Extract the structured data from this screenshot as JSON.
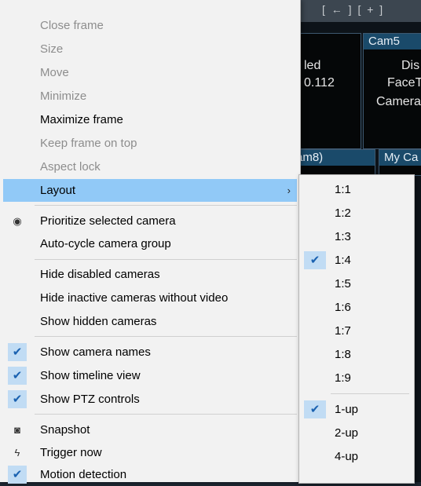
{
  "background": {
    "top_strip_text": "[ ← ] [ + ]",
    "cam5_header": "Cam5",
    "cam8_header": "am8)",
    "mycam_header": "My Ca",
    "tile_left_lines": [
      "led",
      "0.112"
    ],
    "tile_right_lines": [
      "Dis",
      "FaceT",
      "Camera"
    ]
  },
  "main_menu": {
    "items": [
      {
        "label": "Close frame",
        "disabled": true
      },
      {
        "label": "Size",
        "disabled": true
      },
      {
        "label": "Move",
        "disabled": true
      },
      {
        "label": "Minimize",
        "disabled": true
      },
      {
        "label": "Maximize frame",
        "disabled": false
      },
      {
        "label": "Keep frame on top",
        "disabled": true
      },
      {
        "label": "Aspect lock",
        "disabled": true
      },
      {
        "label": "Layout",
        "disabled": false,
        "highlighted": true,
        "submenu_arrow": "›"
      },
      {
        "label": "Prioritize selected camera",
        "icon": "camera-priority-icon"
      },
      {
        "label": "Auto-cycle camera group"
      },
      {
        "label": "Hide disabled cameras"
      },
      {
        "label": "Hide inactive cameras without video"
      },
      {
        "label": "Show hidden cameras"
      },
      {
        "label": "Show camera names",
        "checked": true
      },
      {
        "label": "Show timeline view",
        "checked": true
      },
      {
        "label": "Show PTZ controls",
        "checked": true
      },
      {
        "label": "Snapshot",
        "icon": "camera-icon"
      },
      {
        "label": "Trigger now",
        "icon": "lightning-icon"
      },
      {
        "label": "Motion detection",
        "checked": true
      }
    ],
    "check_glyph": "✔",
    "camera_priority_glyph": "◉",
    "camera_glyph": "◙",
    "lightning_glyph": "ϟ"
  },
  "layout_submenu": {
    "items": [
      {
        "label": "1:1"
      },
      {
        "label": "1:2"
      },
      {
        "label": "1:3"
      },
      {
        "label": "1:4",
        "checked": true
      },
      {
        "label": "1:5"
      },
      {
        "label": "1:6"
      },
      {
        "label": "1:7"
      },
      {
        "label": "1:8"
      },
      {
        "label": "1:9"
      },
      {
        "label": "1-up",
        "checked": true
      },
      {
        "label": "2-up"
      },
      {
        "label": "4-up"
      }
    ]
  },
  "colors": {
    "highlight": "#91c9f7",
    "check_bg": "#c1dcf4",
    "check_fg": "#1a61b0",
    "disabled_text": "#8d8d8d",
    "menu_bg": "#f2f2f2"
  }
}
